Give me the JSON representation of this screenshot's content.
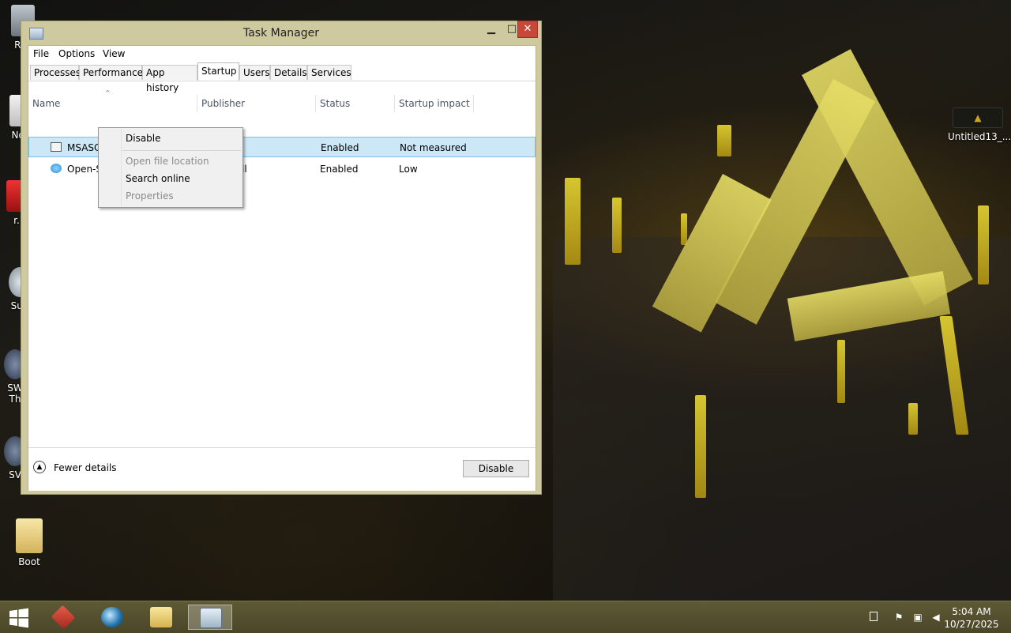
{
  "window": {
    "title": "Task Manager",
    "controls": {
      "minimize": "▁",
      "maximize": "□",
      "close": "✕"
    }
  },
  "menu": [
    "File",
    "Options",
    "View"
  ],
  "tabs": [
    "Processes",
    "Performance",
    "App history",
    "Startup",
    "Users",
    "Details",
    "Services"
  ],
  "active_tab": "Startup",
  "columns": {
    "name": "Name",
    "publisher": "Publisher",
    "status": "Status",
    "impact": "Startup impact",
    "sort_indicator": "^"
  },
  "rows": [
    {
      "name": "MSASCuiL",
      "publisher": "",
      "status": "Enabled",
      "impact": "Not measured",
      "selected": true
    },
    {
      "name": "Open-S",
      "publisher": "ll",
      "status": "Enabled",
      "impact": "Low",
      "selected": false
    }
  ],
  "context_menu": {
    "disable": "Disable",
    "open_file_location": "Open file location",
    "search_online": "Search online",
    "properties": "Properties"
  },
  "footer": {
    "fewer_details": "Fewer details",
    "disable_button": "Disable"
  },
  "desktop_icons": {
    "recycle": "Rec",
    "note": "Not",
    "r": "r.",
    "sup": "Sup",
    "sw1a": "SW",
    "sw1b": "Th",
    "sw2": "SV",
    "boot": "Boot",
    "untitled": "Untitled13_..."
  },
  "taskbar": {
    "time": "5:04 AM",
    "date": "10/27/2025"
  },
  "colors": {
    "window_frame": "#cfc9a0",
    "close_button": "#c7473a",
    "selection": "#cce8f6",
    "taskbar": "#5e5a36",
    "accent_yellow": "#f4e235"
  }
}
